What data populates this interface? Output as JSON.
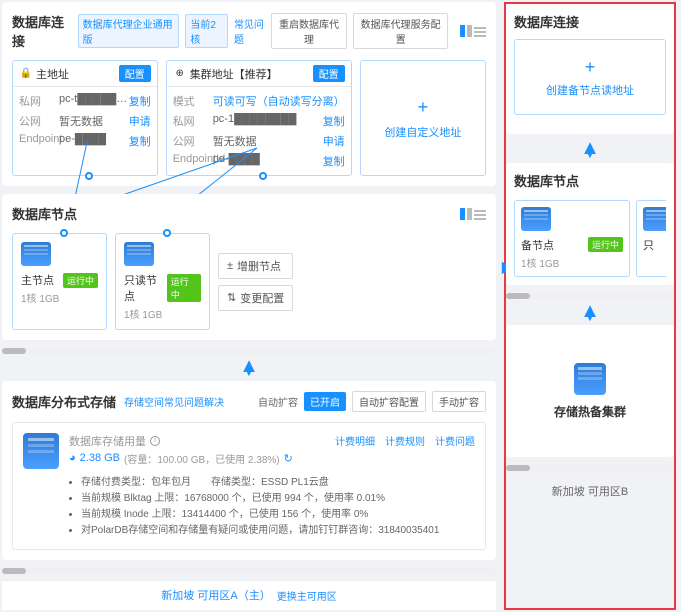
{
  "left": {
    "conn": {
      "title": "数据库连接",
      "proxy_tag": "数据库代理企业通用版",
      "backend_tag": "当前2核",
      "faq": "常见问题",
      "restart_btn": "重启数据库代理",
      "svc_cfg_btn": "数据库代理服务配置",
      "primary": {
        "title": "主地址",
        "cfg": "配置",
        "rows": [
          {
            "l": "私网",
            "v": "pc-t████████",
            "a": "复制"
          },
          {
            "l": "公网",
            "v": "暂无数据",
            "a": "申请"
          },
          {
            "l": "Endpoint",
            "v": "pe-████",
            "a": "复制"
          }
        ]
      },
      "cluster": {
        "title": "集群地址【推荐】",
        "cfg": "配置",
        "mode_l": "模式",
        "mode_v": "可读可写（自动读写分离）",
        "rows": [
          {
            "l": "私网",
            "v": "pc-1████████",
            "a": "复制"
          },
          {
            "l": "公网",
            "v": "暂无数据",
            "a": "申请"
          },
          {
            "l": "EndpointId",
            "v": "pe-████",
            "a": "复制"
          }
        ]
      },
      "custom": {
        "plus": "+",
        "label": "创建自定义地址"
      }
    },
    "nodes": {
      "title": "数据库节点",
      "items": [
        {
          "name": "主节点",
          "status": "运行中",
          "spec": "1核 1GB"
        },
        {
          "name": "只读节点",
          "status": "运行中",
          "spec": "1核 1GB"
        }
      ],
      "add_del": "增删节点",
      "change": "变更配置"
    },
    "storage": {
      "title": "数据库分布式存储",
      "faq": "存储空间常见问题解决",
      "auto_expand_l": "自动扩容",
      "auto_expand_v": "已开启",
      "auto_cfg": "自动扩容配置",
      "manual": "手动扩容",
      "usage_label": "数据库存储用量",
      "usage_val": "2.38 GB",
      "cap": "(容量：100.00 GB，已使用 2.38%)",
      "links": [
        "计费明细",
        "计费规则",
        "计费问题"
      ],
      "items": [
        "存储付费类型：包年包月　　存储类型：ESSD PL1云盘",
        "当前规模 Blktag 上限：16768000 个，已使用 994 个，使用率 0.01%",
        "当前规模 Inode 上限：13414400 个，已使用 156 个，使用率 0%",
        "对PolarDB存储空间和存储量有疑问或使用问题，请加钉钉群咨询：31840035401"
      ]
    },
    "footer": {
      "region": "新加坡 可用区A（主）",
      "change": "更换主可用区"
    }
  },
  "right": {
    "conn": {
      "title": "数据库连接",
      "plus": "+",
      "label": "创建备节点读地址"
    },
    "nodes": {
      "title": "数据库节点",
      "items": [
        {
          "name": "备节点",
          "status": "运行中",
          "spec": "1核 1GB"
        },
        {
          "name": "只",
          "status": "",
          "spec": ""
        }
      ]
    },
    "storage": {
      "label": "存储热备集群"
    },
    "footer": "新加坡 可用区B"
  }
}
